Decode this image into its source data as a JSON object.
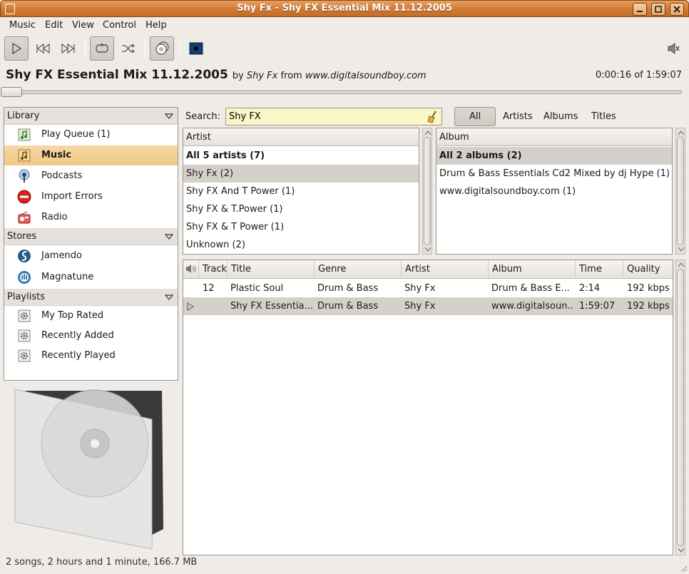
{
  "window": {
    "title": "Shy Fx - Shy FX Essential Mix 11.12.2005"
  },
  "menu": {
    "music": "Music",
    "edit": "Edit",
    "view": "View",
    "control": "Control",
    "help": "Help"
  },
  "now_playing": {
    "title": "Shy FX Essential Mix 11.12.2005",
    "by_word": "by",
    "artist": "Shy Fx",
    "from_word": "from",
    "album": "www.digitalsoundboy.com",
    "time": "0:00:16 of 1:59:07",
    "progress_fraction": 0.002
  },
  "sidebar": {
    "library_header": "Library",
    "library_items": [
      {
        "label": "Play Queue (1)",
        "icon": "play-queue-icon"
      },
      {
        "label": "Music",
        "icon": "music-icon"
      },
      {
        "label": "Podcasts",
        "icon": "podcast-icon"
      },
      {
        "label": "Import Errors",
        "icon": "error-icon"
      },
      {
        "label": "Radio",
        "icon": "radio-icon"
      }
    ],
    "stores_header": "Stores",
    "stores_items": [
      {
        "label": "Jamendo",
        "icon": "jamendo-icon"
      },
      {
        "label": "Magnatune",
        "icon": "magnatune-icon"
      }
    ],
    "playlists_header": "Playlists",
    "playlist_items": [
      {
        "label": "My Top Rated",
        "icon": "smart-playlist-icon"
      },
      {
        "label": "Recently Added",
        "icon": "smart-playlist-icon"
      },
      {
        "label": "Recently Played",
        "icon": "smart-playlist-icon"
      }
    ]
  },
  "search": {
    "label": "Search:",
    "value": "Shy FX"
  },
  "filters": {
    "all": "All",
    "artists": "Artists",
    "albums": "Albums",
    "titles": "Titles"
  },
  "artist_browser": {
    "header": "Artist",
    "all_row": "All 5 artists (7)",
    "rows": [
      "Shy Fx (2)",
      "Shy FX And T Power (1)",
      "Shy FX & T.Power (1)",
      "Shy FX & T Power (1)",
      "Unknown (2)"
    ]
  },
  "album_browser": {
    "header": "Album",
    "all_row": "All 2 albums (2)",
    "rows": [
      "Drum & Bass Essentials Cd2 Mixed by dj Hype (1)",
      "www.digitalsoundboy.com (1)"
    ]
  },
  "tracks": {
    "columns": {
      "track": "Track",
      "title": "Title",
      "genre": "Genre",
      "artist": "Artist",
      "album": "Album",
      "time": "Time",
      "quality": "Quality"
    },
    "rows": [
      {
        "track": "12",
        "title": "Plastic Soul",
        "genre": "Drum & Bass",
        "artist": "Shy Fx",
        "album": "Drum & Bass E...",
        "time": "2:14",
        "quality": "192 kbps"
      },
      {
        "track": "",
        "title": "Shy FX Essentia...",
        "genre": "Drum & Bass",
        "artist": "Shy Fx",
        "album": "www.digitalsoun...",
        "time": "1:59:07",
        "quality": "192 kbps"
      }
    ]
  },
  "status": {
    "text": "2 songs, 2 hours and 1 minute, 166.7 MB"
  }
}
